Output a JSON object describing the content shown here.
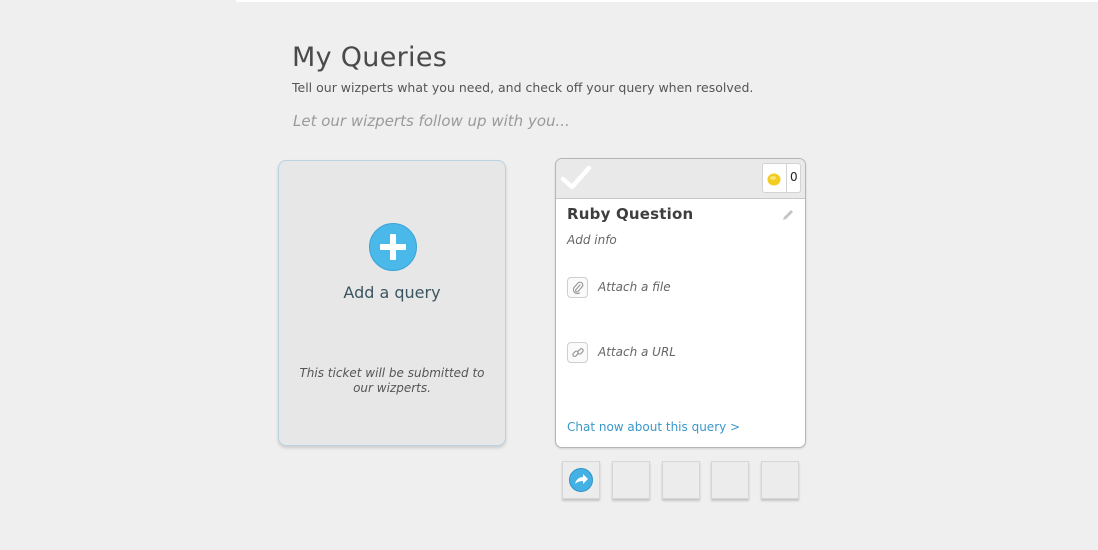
{
  "page": {
    "title": "My Queries",
    "subtitle": "Tell our wizperts what you need, and check off your query when resolved.",
    "followup_prompt": "Let our wizperts follow up with you..."
  },
  "add_card": {
    "label": "Add a query",
    "note": "This ticket will be submitted to our wizperts.",
    "icon": "plus-circle-icon",
    "accent_color": "#4bb8ea"
  },
  "query_card": {
    "title": "Ruby Question",
    "add_info_placeholder": "Add info",
    "coin_count": "0",
    "attach_file_label": "Attach a file",
    "attach_url_label": "Attach a URL",
    "chat_link": "Chat now about this query >",
    "icons": [
      "check-icon",
      "coin-icon",
      "pencil-icon",
      "paperclip-icon",
      "link-icon"
    ],
    "link_color": "#3a98c9",
    "coin_color": "#f2cc1f"
  },
  "action_tiles": [
    {
      "icon": "share-icon"
    },
    {
      "icon": ""
    },
    {
      "icon": ""
    },
    {
      "icon": ""
    },
    {
      "icon": ""
    }
  ]
}
